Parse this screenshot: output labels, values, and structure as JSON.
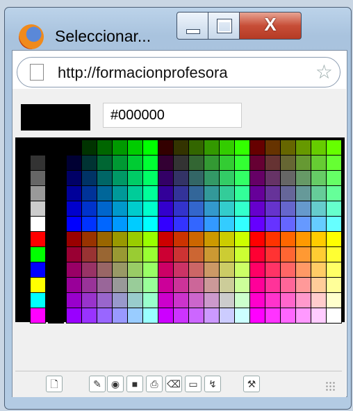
{
  "window": {
    "title": "Seleccionar..."
  },
  "titlebar_buttons": {
    "close_label": "X"
  },
  "address_bar": {
    "url": "http://formacionprofesora"
  },
  "color_picker": {
    "current_color": "#000000",
    "hex_value": "#000000"
  },
  "colors": {
    "close_red": "#c74e38",
    "accent": "#ff0000"
  },
  "toolbar_icons": [
    "new-document-icon",
    "edit-icon",
    "globe-icon",
    "save-icon",
    "print-icon",
    "erase-icon",
    "note-icon",
    "chart-icon",
    "tools-icon"
  ]
}
